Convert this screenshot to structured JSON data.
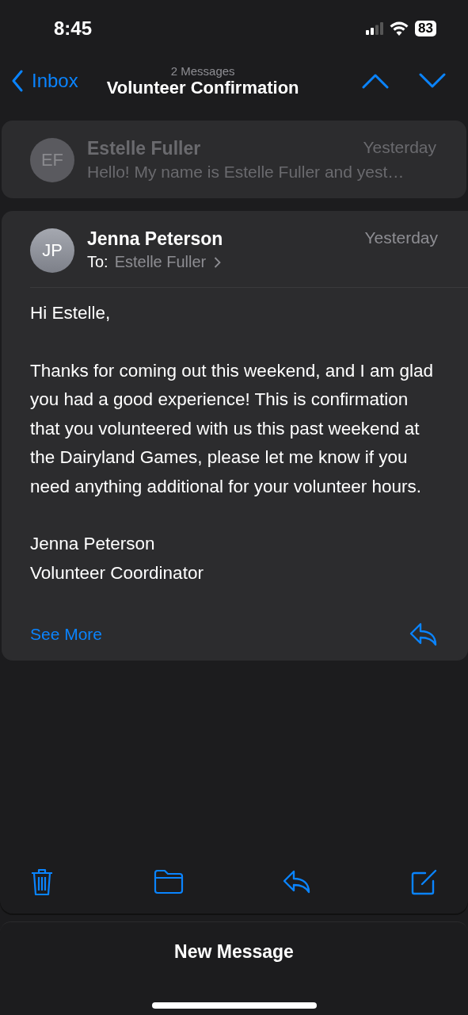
{
  "status_bar": {
    "time": "8:45",
    "battery": "83"
  },
  "nav": {
    "back": "Inbox",
    "subtitle": "2 Messages",
    "title": "Volunteer Confirmation"
  },
  "messages": [
    {
      "kind": "collapsed",
      "initials": "EF",
      "sender": "Estelle Fuller",
      "date": "Yesterday",
      "preview": "Hello! My name is Estelle Fuller and yest…"
    },
    {
      "kind": "expanded",
      "initials": "JP",
      "sender": "Jenna Peterson",
      "date": "Yesterday",
      "to_label": "To:",
      "to": "Estelle Fuller",
      "paragraphs": [
        "Hi Estelle,",
        "Thanks for coming out this weekend, and I am glad you had a good experience! This is confirmation that you volunteered with us this past weekend at the Dairyland Games, please let me know if you need anything additional for your volunteer hours.",
        "Jenna Peterson\nVolunteer Coordinator"
      ],
      "see_more": "See More"
    }
  ],
  "sheet": {
    "title": "New Message"
  }
}
